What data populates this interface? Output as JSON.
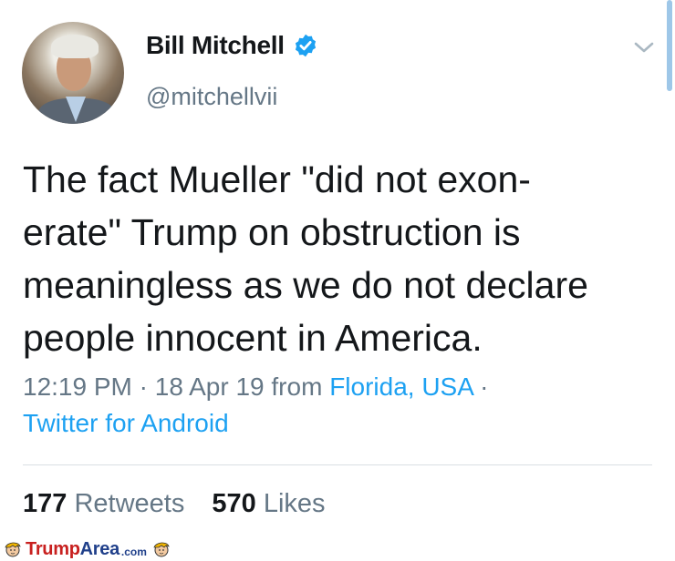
{
  "author": {
    "name": "Bill Mitchell",
    "handle": "@mitchellvii",
    "verified": true
  },
  "tweet": {
    "text": "The fact Mueller \"did not exon-\nerate\" Trump on obstruction is\nmeaningless as we do not declare\npeople innocent in America.",
    "time": "12:19 PM",
    "date": "18 Apr 19",
    "from_word": "from",
    "location": "Florida, USA",
    "client": "Twitter for Android",
    "separator": "·"
  },
  "stats": {
    "retweets_count": "177",
    "retweets_label": "Retweets",
    "likes_count": "570",
    "likes_label": "Likes"
  },
  "watermark": {
    "text_red": "Trump",
    "text_blue": "Area",
    "suffix": ".com"
  },
  "colors": {
    "link": "#1da1f2",
    "secondary": "#657786",
    "verified_badge": "#1da1f2",
    "watermark_red": "#c8201f",
    "watermark_blue": "#1f3f8a"
  },
  "icons": {
    "verified": "verified-badge-icon",
    "more": "chevron-down-icon",
    "watermark": "trump-caricature-icon"
  }
}
